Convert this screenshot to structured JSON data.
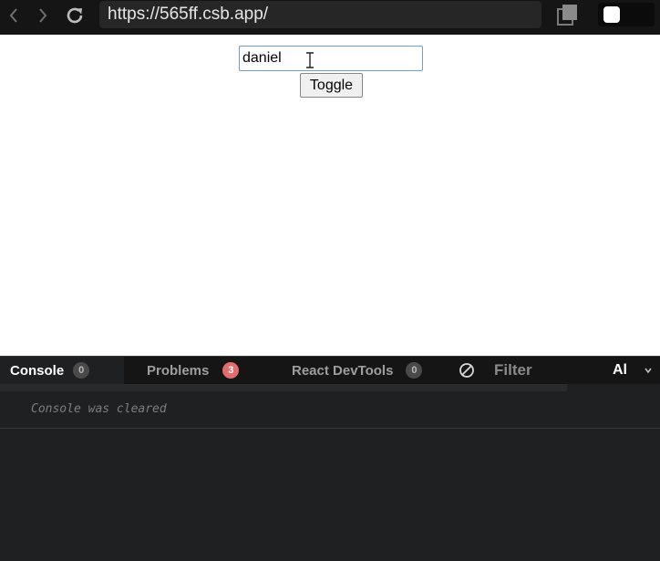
{
  "browser": {
    "url": "https://565ff.csb.app/"
  },
  "preview": {
    "input_value": "daniel",
    "toggle_label": "Toggle"
  },
  "console": {
    "tabs": [
      {
        "label": "Console",
        "badge": "0"
      },
      {
        "label": "Problems",
        "badge": "3"
      },
      {
        "label": "React DevTools",
        "badge": "0"
      }
    ],
    "filter_label": "Filter",
    "level_label": "Al",
    "message": "Console was cleared"
  },
  "colors": {
    "toolbar_bg": "#151515",
    "console_bg": "#1f2022",
    "problems_badge": "#e06c6c",
    "input_focus_border": "#6a9fd3"
  },
  "icons": [
    "chevron-left-icon",
    "chevron-right-icon",
    "reload-icon",
    "copy-icon",
    "text-cursor-icon",
    "clear-console-icon",
    "chevron-down-icon"
  ]
}
